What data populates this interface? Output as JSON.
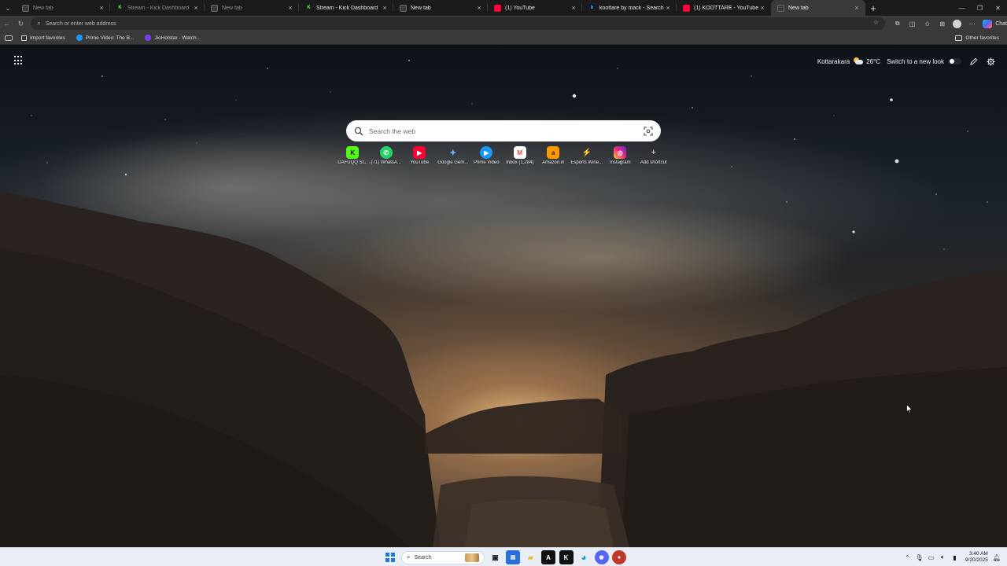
{
  "tabs": [
    {
      "title": "New tab",
      "favicon": "edge-newtab-icon",
      "state": "dim"
    },
    {
      "title": "Stream - Kick Dashboard",
      "favicon": "kick-icon",
      "state": "dim"
    },
    {
      "title": "New tab",
      "favicon": "edge-newtab-icon",
      "state": "dim"
    },
    {
      "title": "Stream - Kick Dashboard",
      "favicon": "kick-icon",
      "state": "bright"
    },
    {
      "title": "New tab",
      "favicon": "edge-newtab-icon",
      "state": "bright"
    },
    {
      "title": "(1) YouTube",
      "favicon": "youtube-icon",
      "state": "bright"
    },
    {
      "title": "koottare by mack - Search",
      "favicon": "bing-search-icon",
      "state": "bright"
    },
    {
      "title": "(1) KOOTTARE - YouTube",
      "favicon": "youtube-icon",
      "state": "bright"
    },
    {
      "title": "New tab",
      "favicon": "edge-newtab-icon",
      "state": "active"
    }
  ],
  "toolbar": {
    "address_placeholder": "Search or enter web address",
    "copilot_label": "Chat"
  },
  "favorites_bar": {
    "items": [
      {
        "label": "Import favorites",
        "icon": "import-icon"
      },
      {
        "label": "Prime Video: The B...",
        "icon": "prime-video-icon"
      },
      {
        "label": "JioHotstar - Watch...",
        "icon": "jiohotstar-icon"
      }
    ],
    "other_label": "Other favorites"
  },
  "ntp": {
    "location": "Kottarakara",
    "temperature": "26°C",
    "new_look_label": "Switch to a new look",
    "search_placeholder": "Search the web",
    "shortcuts": [
      {
        "label": "DAFUQQ St...",
        "icon": "kick-icon",
        "glyph": "K"
      },
      {
        "label": "(71) WhatsA...",
        "icon": "whatsapp-icon",
        "glyph": "✆"
      },
      {
        "label": "YouTube",
        "icon": "youtube-icon",
        "glyph": "▶"
      },
      {
        "label": "Google Gem...",
        "icon": "gemini-icon",
        "glyph": "✦"
      },
      {
        "label": "Prime Video",
        "icon": "prime-video-icon",
        "glyph": "▶"
      },
      {
        "label": "Inbox (1,284)",
        "icon": "gmail-icon",
        "glyph": "M"
      },
      {
        "label": "Amazon.in",
        "icon": "amazon-icon",
        "glyph": "a"
      },
      {
        "label": "Esports Wine...",
        "icon": "esports-icon",
        "glyph": "⚡"
      },
      {
        "label": "Instagram",
        "icon": "instagram-icon",
        "glyph": "◎"
      },
      {
        "label": "Add shortcut",
        "icon": "plus-icon",
        "glyph": "+"
      }
    ]
  },
  "taskbar": {
    "search_label": "Search",
    "time": "3:40 AM",
    "date": "9/20/2025"
  },
  "colors": {
    "accent": "#0078d4",
    "kick_green": "#53fc18",
    "youtube_red": "#ff0033"
  }
}
